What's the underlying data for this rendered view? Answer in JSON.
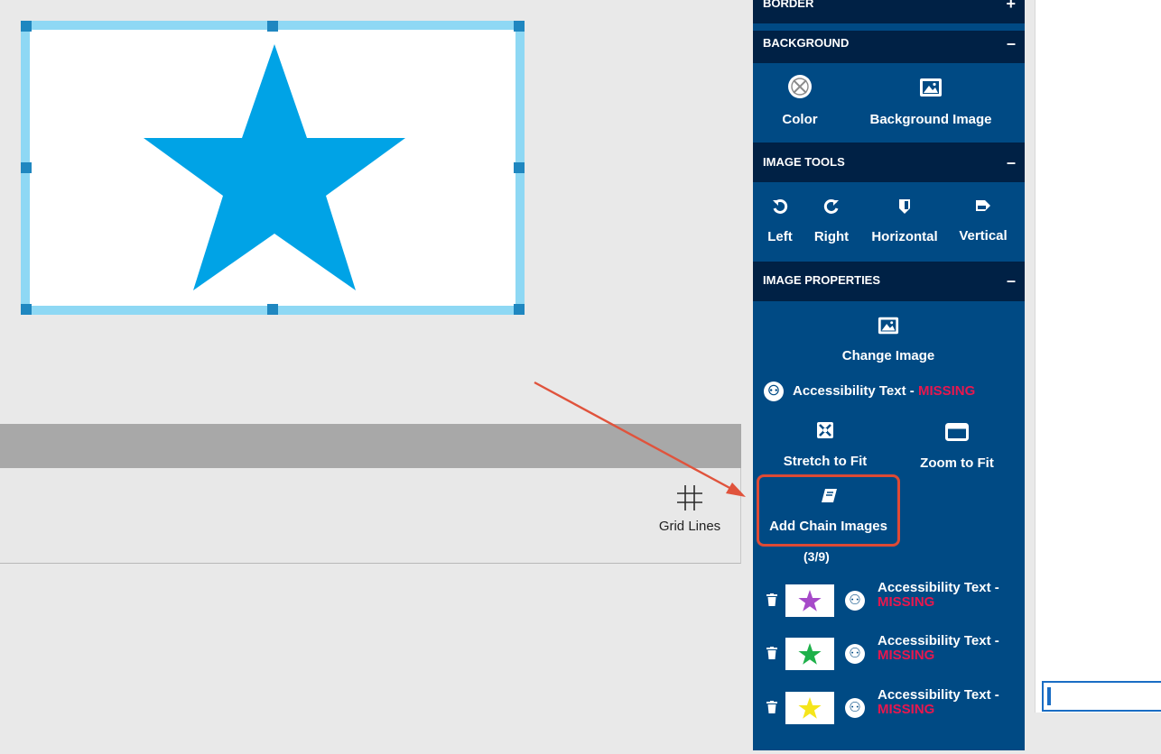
{
  "canvas": {
    "shape_icon": "star-shape",
    "shape_color": "#00a3e6",
    "selection_color": "#8ed8f4"
  },
  "toolbar": {
    "grid_lines_label": "Grid Lines",
    "grid_lines_icon": "grid-icon"
  },
  "panel": {
    "border": {
      "title": "BORDER",
      "toggle": "+"
    },
    "background": {
      "title": "BACKGROUND",
      "toggle": "–",
      "color_label": "Color",
      "background_image_label": "Background Image"
    },
    "image_tools": {
      "title": "IMAGE TOOLS",
      "toggle": "–",
      "left_label": "Left",
      "right_label": "Right",
      "horizontal_label": "Horizontal",
      "vertical_label": "Vertical"
    },
    "image_properties": {
      "title": "IMAGE PROPERTIES",
      "toggle": "–",
      "change_image_label": "Change Image",
      "accessibility_label": "Accessibility Text - ",
      "accessibility_status": "MISSING",
      "stretch_label": "Stretch to Fit",
      "zoom_label": "Zoom to Fit",
      "add_chain_label": "Add Chain Images",
      "chain_count": "(3/9)"
    },
    "chain_images": [
      {
        "star_color": "#a64ac9",
        "acc_label": "Accessibility Text -",
        "acc_status": "MISSING"
      },
      {
        "star_color": "#1fb14a",
        "acc_label": "Accessibility Text -",
        "acc_status": "MISSING"
      },
      {
        "star_color": "#f5e51b",
        "acc_label": "Accessibility Text -",
        "acc_status": "MISSING"
      }
    ]
  }
}
